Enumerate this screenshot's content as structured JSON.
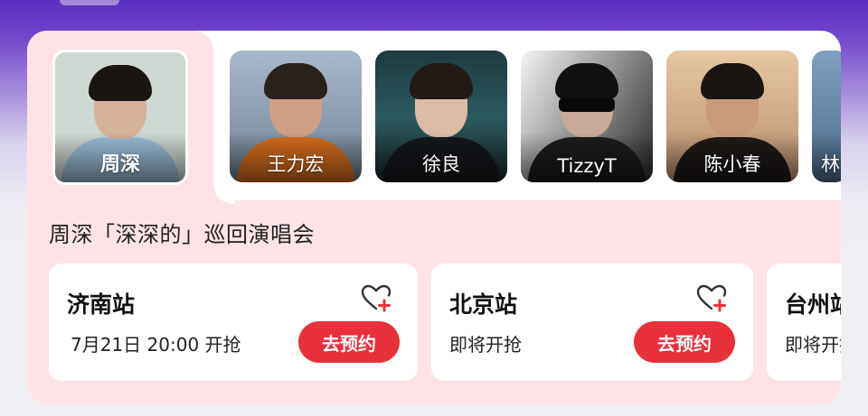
{
  "artists": [
    {
      "name": "周深",
      "active": true
    },
    {
      "name": "王力宏",
      "active": false
    },
    {
      "name": "徐良",
      "active": false
    },
    {
      "name": "TizzyT",
      "active": false
    },
    {
      "name": "陈小春",
      "active": false
    },
    {
      "name": "林",
      "active": false
    }
  ],
  "tour": {
    "title": "周深「深深的」巡回演唱会"
  },
  "shows": [
    {
      "city": "济南站",
      "time": "7月21日 20:00 开抢",
      "button": "去预约"
    },
    {
      "city": "北京站",
      "time": "即将开抢",
      "button": "去预约"
    },
    {
      "city": "台州站",
      "time": "即将开抢"
    }
  ],
  "colors": {
    "accent": "#e8313a",
    "panel": "#fde3e6",
    "header": "#5a2fc2"
  },
  "icons": {
    "favorite": "heart-plus-icon"
  }
}
